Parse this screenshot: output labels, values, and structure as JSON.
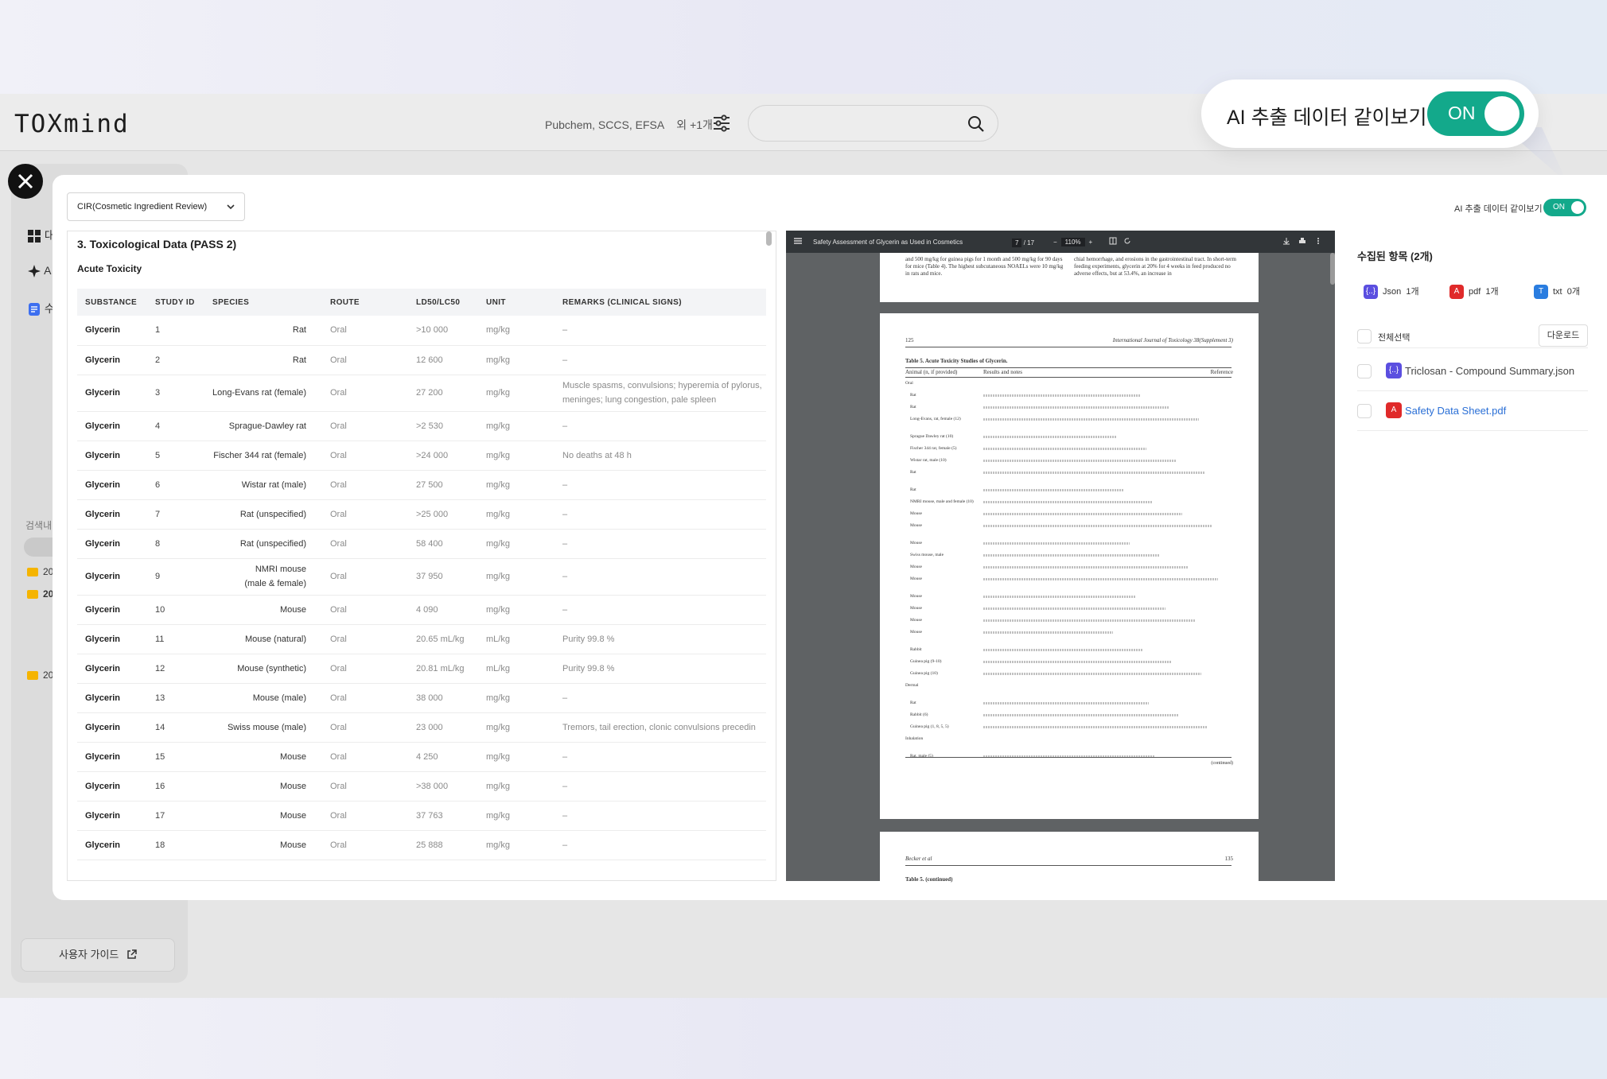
{
  "app": {
    "logo": "TOXmind",
    "sources": "Pubchem, SCCS, EFSA",
    "sources_more": "외 +1개",
    "search_placeholder": ""
  },
  "ai_pill": {
    "label": "AI 추출 데이터 같이보기",
    "state": "ON"
  },
  "sidebar": {
    "items": [
      {
        "label": "대",
        "icon": "grid-icon"
      },
      {
        "label": "A",
        "icon": "sparkle-icon"
      },
      {
        "label": "수",
        "icon": "document-icon"
      }
    ],
    "search_label": "검색내",
    "folders": [
      "20",
      "20",
      "20"
    ],
    "guide_button": "사용자 가이드"
  },
  "modal": {
    "source_dropdown": "CIR(Cosmetic Ingredient Review)",
    "ai_toggle_label": "AI 추출 데이터 같이보기",
    "ai_toggle_state": "ON",
    "section_title": "3. Toxicological Data (PASS 2)",
    "subsection_title": "Acute Toxicity",
    "table": {
      "headers": [
        "SUBSTANCE",
        "STUDY ID",
        "SPECIES",
        "ROUTE",
        "LD50/LC50",
        "UNIT",
        "REMARKS (CLINICAL SIGNS)"
      ],
      "rows": [
        {
          "substance": "Glycerin",
          "id": "1",
          "species": "Rat",
          "species2": "",
          "route": "Oral",
          "ld50": ">10 000",
          "unit": "mg/kg",
          "remarks": "–"
        },
        {
          "substance": "Glycerin",
          "id": "2",
          "species": "Rat",
          "species2": "",
          "route": "Oral",
          "ld50": "12 600",
          "unit": "mg/kg",
          "remarks": "–"
        },
        {
          "substance": "Glycerin",
          "id": "3",
          "species": "Long-Evans rat (female)",
          "species2": "",
          "route": "Oral",
          "ld50": "27 200",
          "unit": "mg/kg",
          "remarks": "Muscle spasms, convulsions; hyperemia of pylorus, meninges; lung congestion, pale spleen"
        },
        {
          "substance": "Glycerin",
          "id": "4",
          "species": "Sprague-Dawley rat",
          "species2": "",
          "route": "Oral",
          "ld50": ">2 530",
          "unit": "mg/kg",
          "remarks": "–"
        },
        {
          "substance": "Glycerin",
          "id": "5",
          "species": "Fischer 344 rat (female)",
          "species2": "",
          "route": "Oral",
          "ld50": ">24 000",
          "unit": "mg/kg",
          "remarks": "No deaths at 48 h"
        },
        {
          "substance": "Glycerin",
          "id": "6",
          "species": "Wistar rat (male)",
          "species2": "",
          "route": "Oral",
          "ld50": "27 500",
          "unit": "mg/kg",
          "remarks": "–"
        },
        {
          "substance": "Glycerin",
          "id": "7",
          "species": "Rat (unspecified)",
          "species2": "",
          "route": "Oral",
          "ld50": ">25 000",
          "unit": "mg/kg",
          "remarks": "–"
        },
        {
          "substance": "Glycerin",
          "id": "8",
          "species": "Rat (unspecified)",
          "species2": "",
          "route": "Oral",
          "ld50": "58 400",
          "unit": "mg/kg",
          "remarks": "–"
        },
        {
          "substance": "Glycerin",
          "id": "9",
          "species": "NMRI mouse",
          "species2": "(male & female)",
          "route": "Oral",
          "ld50": "37 950",
          "unit": "mg/kg",
          "remarks": "–"
        },
        {
          "substance": "Glycerin",
          "id": "10",
          "species": "Mouse",
          "species2": "",
          "route": "Oral",
          "ld50": "4 090",
          "unit": "mg/kg",
          "remarks": "–"
        },
        {
          "substance": "Glycerin",
          "id": "11",
          "species": "Mouse (natural)",
          "species2": "",
          "route": "Oral",
          "ld50": "20.65 mL/kg",
          "unit": "mL/kg",
          "remarks": "Purity 99.8 %"
        },
        {
          "substance": "Glycerin",
          "id": "12",
          "species": "Mouse (synthetic)",
          "species2": "",
          "route": "Oral",
          "ld50": "20.81 mL/kg",
          "unit": "mL/kg",
          "remarks": "Purity 99.8 %"
        },
        {
          "substance": "Glycerin",
          "id": "13",
          "species": "Mouse (male)",
          "species2": "",
          "route": "Oral",
          "ld50": "38 000",
          "unit": "mg/kg",
          "remarks": "–"
        },
        {
          "substance": "Glycerin",
          "id": "14",
          "species": "Swiss mouse (male)",
          "species2": "",
          "route": "Oral",
          "ld50": "23 000",
          "unit": "mg/kg",
          "remarks": "Tremors, tail erection, clonic convulsions precedin"
        },
        {
          "substance": "Glycerin",
          "id": "15",
          "species": "Mouse",
          "species2": "",
          "route": "Oral",
          "ld50": "4 250",
          "unit": "mg/kg",
          "remarks": "–"
        },
        {
          "substance": "Glycerin",
          "id": "16",
          "species": "Mouse",
          "species2": "",
          "route": "Oral",
          "ld50": ">38 000",
          "unit": "mg/kg",
          "remarks": "–"
        },
        {
          "substance": "Glycerin",
          "id": "17",
          "species": "Mouse",
          "species2": "",
          "route": "Oral",
          "ld50": "37 763",
          "unit": "mg/kg",
          "remarks": "–"
        },
        {
          "substance": "Glycerin",
          "id": "18",
          "species": "Mouse",
          "species2": "",
          "route": "Oral",
          "ld50": "25 888",
          "unit": "mg/kg",
          "remarks": "–"
        }
      ]
    },
    "pdf": {
      "title": "Safety Assessment of Glycerin as Used in Cosmetics",
      "page_current": "7",
      "page_total": "/ 17",
      "zoom": "110%",
      "top_page_text_left": "and 500 mg/kg for guinea pigs for 1 month and 500 mg/kg for 90 days for mice (Table 4). The highest subcutaneous NOAELs were 10 mg/kg in rats and mice.",
      "top_page_text_right": "chial hemorrhage, and erosions in the gastrointestinal tract. In short-term feeding experiments, glycerin at 20% for 4 weeks in feed produced no adverse effects, but at 53.4%, an increase in",
      "page_number": "125",
      "journal": "International Journal of Toxicology 38(Supplement 3)",
      "table_caption": "Table 5.  Acute Toxicity Studies of Glycerin.",
      "col_animal": "Animal (n, if provided)",
      "col_results": "Results and notes",
      "col_ref": "Reference",
      "animals": [
        "Oral",
        "Rat",
        "Rat",
        "Long-Evans, rat, female (12)",
        "Sprague Dawley rat (10)",
        "Fischer 344 rat, female (5)",
        "Wistar rat, male (10)",
        "Rat",
        "Rat",
        "NMRI mouse, male and female (10)",
        "Mouse",
        "Mouse",
        "Mouse",
        "Swiss mouse, male",
        "Mouse",
        "Mouse",
        "Mouse",
        "Mouse",
        "Mouse",
        "Mouse",
        "Rabbit",
        "Guinea pig (9-10)",
        "Guinea pig (10)",
        "Dermal",
        "Rat",
        "Rabbit (6)",
        "Guinea pig (1, 8, 5, 5)",
        "Inhalation",
        "Rat, male (5)"
      ],
      "continued": "(continued)",
      "next_page_header_left": "Becker et al",
      "next_page_header_right": "135",
      "next_table_caption": "Table 5. (continued)"
    },
    "files": {
      "title": "수집된 항목 (2개)",
      "types": [
        {
          "icon": "json-icon",
          "label": "Json",
          "count": "1개",
          "color": "#5b4fe0",
          "glyph": "{..}"
        },
        {
          "icon": "pdf-icon",
          "label": "pdf",
          "count": "1개",
          "color": "#e02a2a",
          "glyph": "A"
        },
        {
          "icon": "txt-icon",
          "label": "txt",
          "count": "0개",
          "color": "#2a7de0",
          "glyph": "T"
        }
      ],
      "select_all": "전체선택",
      "download": "다운로드",
      "items": [
        {
          "name": "Triclosan - Compound Summary.json",
          "icon": "json-icon",
          "color": "#5b4fe0",
          "glyph": "{..}",
          "text_color": "#444"
        },
        {
          "name": "Safety Data Sheet.pdf",
          "icon": "pdf-icon",
          "color": "#e02a2a",
          "glyph": "A",
          "text_color": "#2a6fd6"
        }
      ]
    }
  }
}
